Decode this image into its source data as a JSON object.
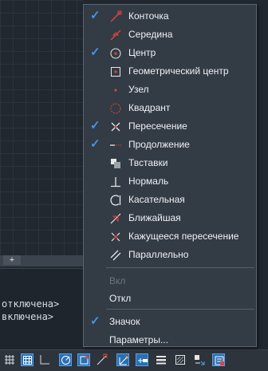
{
  "drawing": {
    "tab_add_label": "+",
    "command_lines": [
      "отключена>",
      "включена>"
    ]
  },
  "osnap_menu": {
    "items": [
      {
        "label": "Конточка",
        "checked": true,
        "icon": "endpoint-icon"
      },
      {
        "label": "Середина",
        "checked": false,
        "icon": "midpoint-icon"
      },
      {
        "label": "Центр",
        "checked": true,
        "icon": "center-icon"
      },
      {
        "label": "Геометрический центр",
        "checked": false,
        "icon": "geometric-center-icon"
      },
      {
        "label": "Узел",
        "checked": false,
        "icon": "node-icon"
      },
      {
        "label": "Квадрант",
        "checked": false,
        "icon": "quadrant-icon"
      },
      {
        "label": "Пересечение",
        "checked": true,
        "icon": "intersection-icon"
      },
      {
        "label": "Продолжение",
        "checked": true,
        "icon": "extension-icon"
      },
      {
        "label": "Твставки",
        "checked": false,
        "icon": "insertion-icon"
      },
      {
        "label": "Нормаль",
        "checked": false,
        "icon": "perpendicular-icon"
      },
      {
        "label": "Касательная",
        "checked": false,
        "icon": "tangent-icon"
      },
      {
        "label": "Ближайшая",
        "checked": false,
        "icon": "nearest-icon"
      },
      {
        "label": "Кажущееся пересечение",
        "checked": false,
        "icon": "apparent-intersection-icon"
      },
      {
        "label": "Параллельно",
        "checked": false,
        "icon": "parallel-icon"
      }
    ],
    "on_label": "Вкл",
    "off_label": "Откл",
    "tracking_label": "Значок",
    "settings_label": "Параметры..."
  },
  "colors": {
    "menu_bg": "#333b45",
    "check": "#3f97e8",
    "snap_marker": "#e0453a",
    "active_button": "#2a6fb3"
  },
  "status_buttons": [
    "grid-icon",
    "grid-display-icon",
    "ortho-icon",
    "polar-tracking-icon",
    "object-snap-icon",
    "snap-tracking-icon",
    "dynamic-ucs-icon",
    "dynamic-input-icon",
    "lineweight-icon",
    "transparency-icon",
    "selection-cycling-icon",
    "annotation-monitor-icon"
  ]
}
